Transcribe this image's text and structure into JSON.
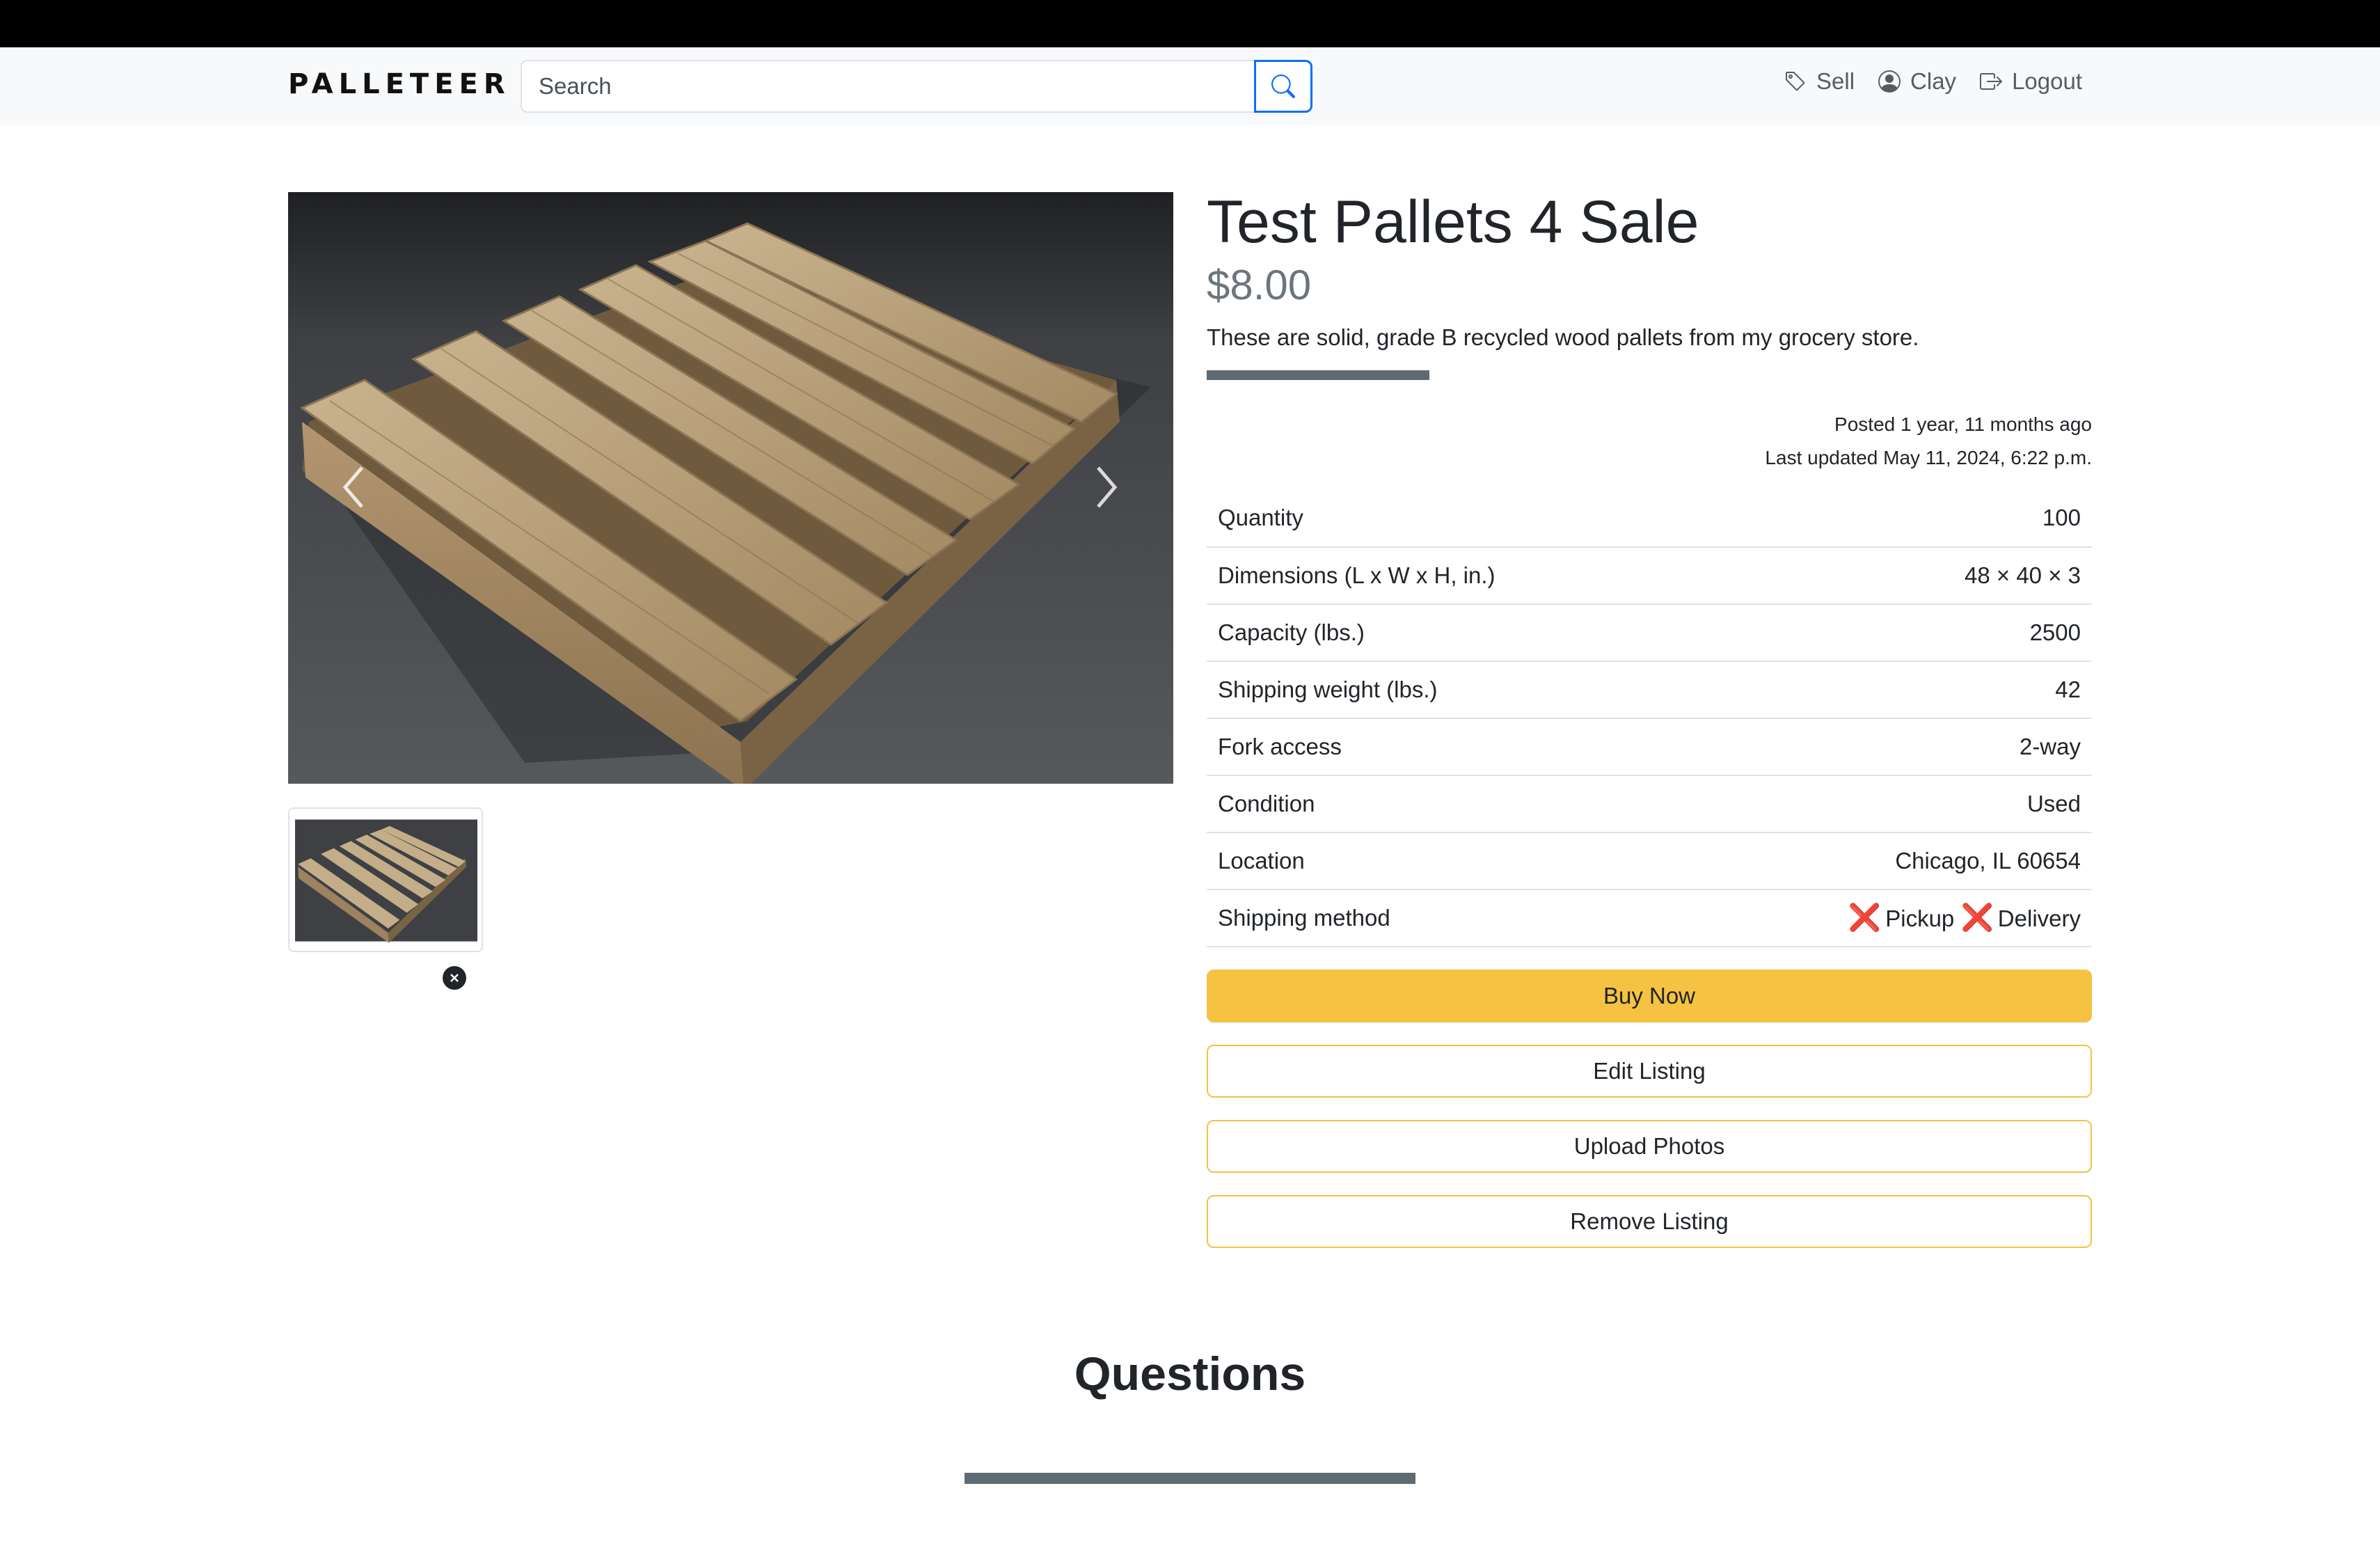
{
  "navbar": {
    "brand": "PALLETEER",
    "search_placeholder": "Search",
    "links": [
      {
        "label": "Sell",
        "icon": "tag-icon"
      },
      {
        "label": "Clay",
        "icon": "user-circle-icon"
      },
      {
        "label": "Logout",
        "icon": "logout-icon"
      }
    ]
  },
  "listing": {
    "title": "Test Pallets 4 Sale",
    "price": "$8.00",
    "description": "These are solid, grade B recycled wood pallets from my grocery store.",
    "posted": "Posted 1 year, 11 months ago",
    "updated": "Last updated May 11, 2024, 6:22 p.m.",
    "specs": [
      {
        "label": "Quantity",
        "value": "100"
      },
      {
        "label": "Dimensions (L x W x H, in.)",
        "value": "48 × 40 × 3"
      },
      {
        "label": "Capacity (lbs.)",
        "value": "2500"
      },
      {
        "label": "Shipping weight (lbs.)",
        "value": "42"
      },
      {
        "label": "Fork access",
        "value": "2-way"
      },
      {
        "label": "Condition",
        "value": "Used"
      },
      {
        "label": "Location",
        "value": "Chicago, IL 60654"
      }
    ],
    "shipping": {
      "label": "Shipping method",
      "options": [
        {
          "label": "Pickup",
          "mark": "❌"
        },
        {
          "label": "Delivery",
          "mark": "❌"
        }
      ]
    },
    "buttons": {
      "buy": "Buy Now",
      "edit": "Edit Listing",
      "upload": "Upload Photos",
      "remove": "Remove Listing"
    }
  },
  "questions": {
    "title": "Questions"
  },
  "colors": {
    "accent": "#f5c242",
    "divider": "#5f6b73",
    "search_button_border": "#0d6efd",
    "cross_mark": "#dc2626"
  }
}
